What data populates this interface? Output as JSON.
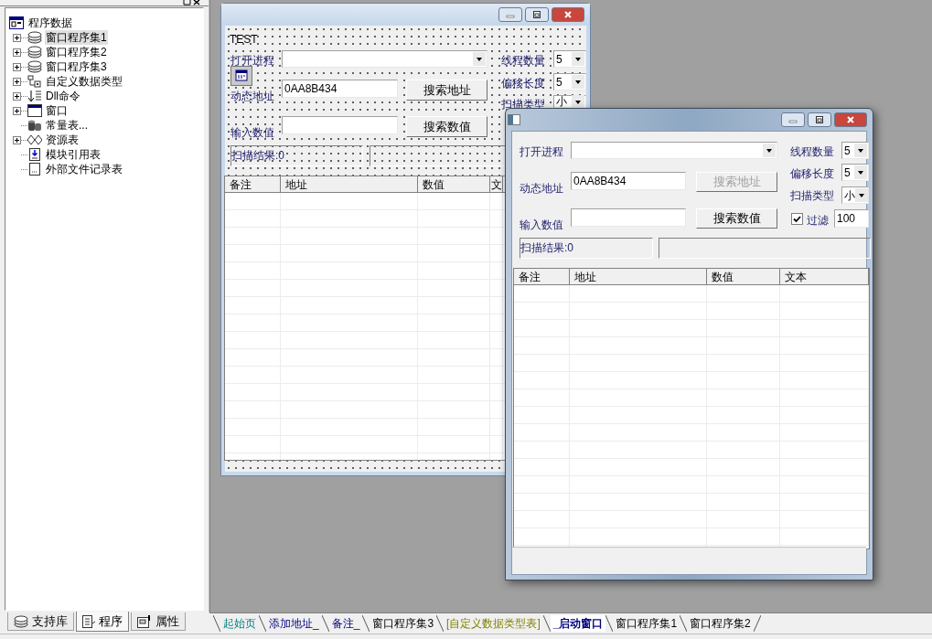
{
  "left_panel": {
    "tree": {
      "label": "程序数据",
      "children": [
        {
          "label": "窗口程序集1",
          "kind": "collapsed",
          "selected": true
        },
        {
          "label": "窗口程序集2",
          "kind": "collapsed",
          "selected": false
        },
        {
          "label": "窗口程序集3",
          "kind": "collapsed",
          "selected": false
        },
        {
          "label": "自定义数据类型",
          "kind": "collapsed",
          "selected": false
        },
        {
          "label": "Dll命令",
          "kind": "collapsed",
          "selected": false
        },
        {
          "label": "窗口",
          "kind": "collapsed",
          "selected": false
        },
        {
          "label": "常量表...",
          "kind": "leaf",
          "selected": false
        },
        {
          "label": "资源表",
          "kind": "collapsed",
          "selected": false
        },
        {
          "label": "模块引用表",
          "kind": "leaf",
          "selected": false
        },
        {
          "label": "外部文件记录表",
          "kind": "leaf",
          "selected": false
        }
      ]
    },
    "tabs": [
      {
        "label": "支持库",
        "selected": false
      },
      {
        "label": "程序",
        "selected": true
      },
      {
        "label": "属性",
        "selected": false
      }
    ]
  },
  "design_window": {
    "caption": "TEST",
    "process_label": "打开进程",
    "address_label": "动态地址",
    "address_value": "0AA8B434",
    "address_button": {
      "label": "搜索地址",
      "disabled": false
    },
    "value_label": "输入数值",
    "value_button": {
      "label": "搜索数值",
      "disabled": false
    },
    "result_label": "扫描结果:0",
    "threads": {
      "label": "线程数量",
      "value": "5"
    },
    "offset": {
      "label": "偏移长度",
      "value": "5"
    },
    "scan_type": {
      "label": "扫描类型",
      "value": "小"
    },
    "columns": [
      "备注",
      "地址",
      "数值",
      "文"
    ]
  },
  "running_window": {
    "process_label": "打开进程",
    "address_label": "动态地址",
    "address_value": "0AA8B434",
    "address_button": {
      "label": "搜索地址",
      "disabled": true
    },
    "value_label": "输入数值",
    "value_button": {
      "label": "搜索数值",
      "disabled": false
    },
    "result_label": "扫描结果:0",
    "threads": {
      "label": "线程数量",
      "value": "5"
    },
    "offset": {
      "label": "偏移长度",
      "value": "5"
    },
    "scan_type": {
      "label": "扫描类型",
      "value": "小"
    },
    "filter": {
      "label": "过滤",
      "checked": true,
      "value": "100"
    },
    "columns": [
      "备注",
      "地址",
      "数值",
      "文本"
    ]
  },
  "document_tabs": [
    {
      "label": "起始页",
      "kind": "start",
      "selected": false
    },
    {
      "label": "添加地址_",
      "kind": "form",
      "selected": false
    },
    {
      "label": "备注_",
      "kind": "form",
      "selected": false
    },
    {
      "label": "窗口程序集3",
      "kind": "module",
      "selected": false
    },
    {
      "label": "[自定义数据类型表]",
      "kind": "types",
      "selected": false
    },
    {
      "label": "_启动窗口",
      "kind": "form",
      "selected": true
    },
    {
      "label": "窗口程序集1",
      "kind": "module",
      "selected": false
    },
    {
      "label": "窗口程序集2",
      "kind": "module",
      "selected": false
    }
  ]
}
